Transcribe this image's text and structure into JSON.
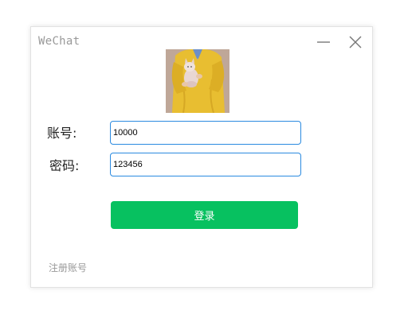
{
  "window": {
    "title": "WeChat",
    "minimize_icon": "minimize-icon",
    "close_icon": "close-icon"
  },
  "avatar": {
    "icon": "avatar-photo"
  },
  "form": {
    "account_label": "账号:",
    "account_value": "10000",
    "password_label": "密码:",
    "password_value": "123456"
  },
  "actions": {
    "login_label": "登录",
    "register_label": "注册账号"
  },
  "colors": {
    "accent_green": "#07c160",
    "input_border": "#2a8ae0",
    "muted_text": "#999999"
  }
}
